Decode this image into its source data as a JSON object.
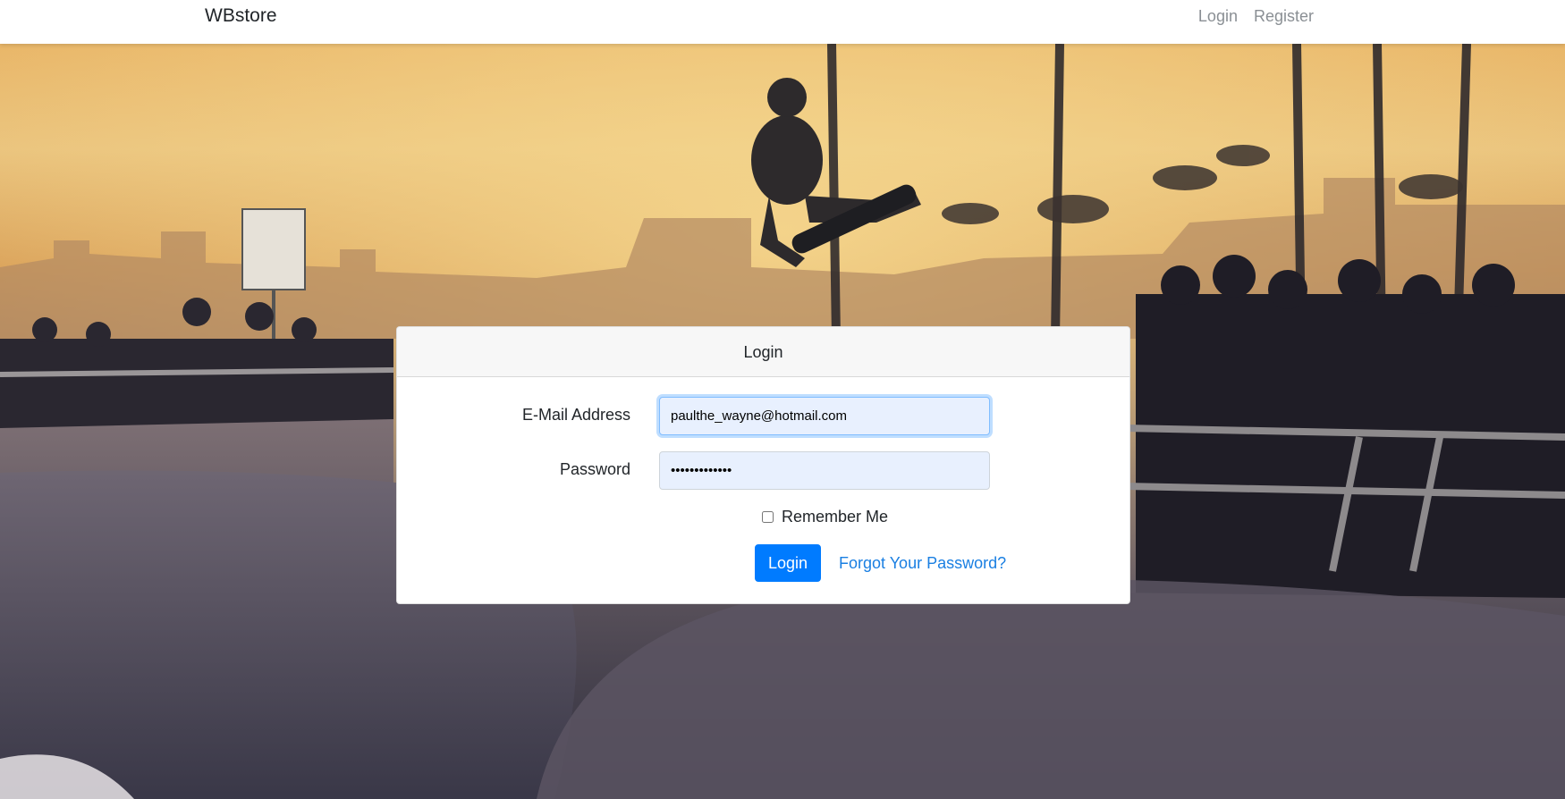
{
  "navbar": {
    "brand": "WBstore",
    "links": [
      {
        "label": "Login"
      },
      {
        "label": "Register"
      }
    ]
  },
  "login_card": {
    "title": "Login",
    "email_label": "E-Mail Address",
    "email_value": "paulthe_wayne@hotmail.com",
    "password_label": "Password",
    "password_value": "•••••••••••••",
    "remember_label": "Remember Me",
    "remember_checked": false,
    "submit_label": "Login",
    "forgot_label": "Forgot Your Password?"
  },
  "colors": {
    "primary": "#007bff",
    "link": "#1a7fe2",
    "input_autofill_bg": "#e8f0fe"
  }
}
